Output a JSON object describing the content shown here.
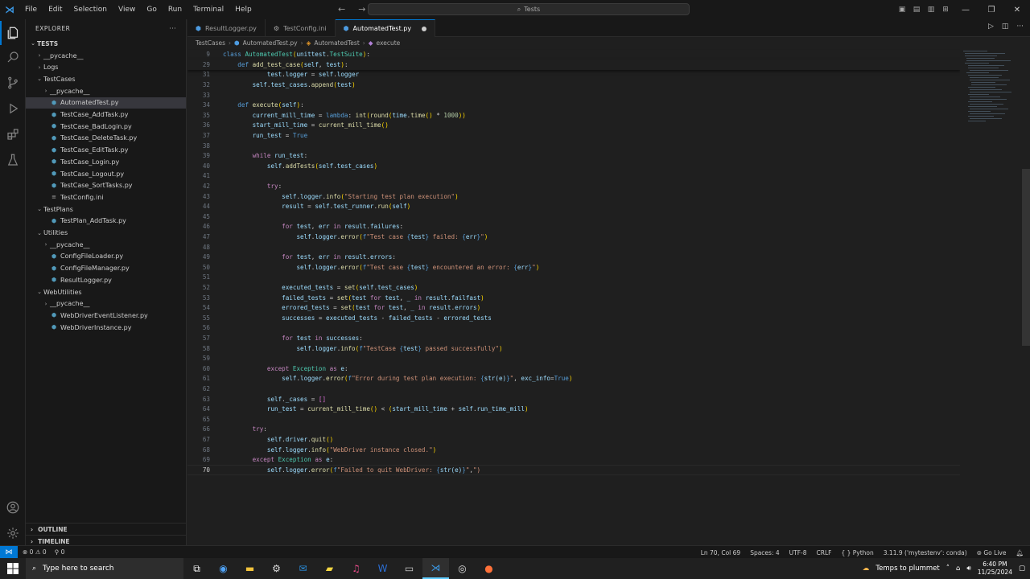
{
  "titlebar": {
    "menus": [
      "File",
      "Edit",
      "Selection",
      "View",
      "Go",
      "Run",
      "Terminal",
      "Help"
    ],
    "search_text": "Tests"
  },
  "sidebar": {
    "header": "EXPLORER",
    "items": [
      {
        "label": "TESTS",
        "depth": 0,
        "kind": "root",
        "chev": "v"
      },
      {
        "label": "__pycache__",
        "depth": 1,
        "kind": "folder",
        "chev": ">"
      },
      {
        "label": "Logs",
        "depth": 1,
        "kind": "folder",
        "chev": ">"
      },
      {
        "label": "TestCases",
        "depth": 1,
        "kind": "folder",
        "chev": "v"
      },
      {
        "label": "__pycache__",
        "depth": 2,
        "kind": "folder",
        "chev": ">"
      },
      {
        "label": "AutomatedTest.py",
        "depth": 2,
        "kind": "py",
        "selected": true
      },
      {
        "label": "TestCase_AddTask.py",
        "depth": 2,
        "kind": "py"
      },
      {
        "label": "TestCase_BadLogin.py",
        "depth": 2,
        "kind": "py"
      },
      {
        "label": "TestCase_DeleteTask.py",
        "depth": 2,
        "kind": "py"
      },
      {
        "label": "TestCase_EditTask.py",
        "depth": 2,
        "kind": "py"
      },
      {
        "label": "TestCase_Login.py",
        "depth": 2,
        "kind": "py"
      },
      {
        "label": "TestCase_Logout.py",
        "depth": 2,
        "kind": "py"
      },
      {
        "label": "TestCase_SortTasks.py",
        "depth": 2,
        "kind": "py"
      },
      {
        "label": "TestConfig.ini",
        "depth": 2,
        "kind": "ini"
      },
      {
        "label": "TestPlans",
        "depth": 1,
        "kind": "folder",
        "chev": "v"
      },
      {
        "label": "TestPlan_AddTask.py",
        "depth": 2,
        "kind": "py"
      },
      {
        "label": "Utilities",
        "depth": 1,
        "kind": "folder",
        "chev": "v"
      },
      {
        "label": "__pycache__",
        "depth": 2,
        "kind": "folder",
        "chev": ">"
      },
      {
        "label": "ConfigFileLoader.py",
        "depth": 2,
        "kind": "py"
      },
      {
        "label": "ConfigFileManager.py",
        "depth": 2,
        "kind": "py"
      },
      {
        "label": "ResultLogger.py",
        "depth": 2,
        "kind": "py"
      },
      {
        "label": "WebUtilities",
        "depth": 1,
        "kind": "folder",
        "chev": "v"
      },
      {
        "label": "__pycache__",
        "depth": 2,
        "kind": "folder",
        "chev": ">"
      },
      {
        "label": "WebDriverEventListener.py",
        "depth": 2,
        "kind": "py"
      },
      {
        "label": "WebDriverInstance.py",
        "depth": 2,
        "kind": "py"
      }
    ],
    "outline": "OUTLINE",
    "timeline": "TIMELINE"
  },
  "tabs": [
    {
      "label": "ResultLogger.py",
      "active": false
    },
    {
      "label": "TestConfig.ini",
      "active": false
    },
    {
      "label": "AutomatedTest.py",
      "active": true
    }
  ],
  "breadcrumb": [
    "TestCases",
    "AutomatedTest.py",
    "AutomatedTest",
    "execute"
  ],
  "editor": {
    "lines": [
      {
        "n": "9",
        "t": "class AutomatedTest(unittest.TestSuite):",
        "sticky": true
      },
      {
        "n": "29",
        "t": "    def add_test_case(self, test):",
        "sticky": true
      },
      {
        "n": "31",
        "t": "            test.logger = self.logger"
      },
      {
        "n": "32",
        "t": "        self.test_cases.append(test)"
      },
      {
        "n": "33",
        "t": ""
      },
      {
        "n": "34",
        "t": "    def execute(self):"
      },
      {
        "n": "35",
        "t": "        current_mill_time = lambda: int(round(time.time() * 1000))"
      },
      {
        "n": "36",
        "t": "        start_mill_time = current_mill_time()"
      },
      {
        "n": "37",
        "t": "        run_test = True"
      },
      {
        "n": "38",
        "t": ""
      },
      {
        "n": "39",
        "t": "        while run_test:"
      },
      {
        "n": "40",
        "t": "            self.addTests(self.test_cases)"
      },
      {
        "n": "41",
        "t": ""
      },
      {
        "n": "42",
        "t": "            try:"
      },
      {
        "n": "43",
        "t": "                self.logger.info(\"Starting test plan execution\")"
      },
      {
        "n": "44",
        "t": "                result = self.test_runner.run(self)"
      },
      {
        "n": "45",
        "t": ""
      },
      {
        "n": "46",
        "t": "                for test, err in result.failures:"
      },
      {
        "n": "47",
        "t": "                    self.logger.error(f\"Test case {test} failed: {err}\")"
      },
      {
        "n": "48",
        "t": ""
      },
      {
        "n": "49",
        "t": "                for test, err in result.errors:"
      },
      {
        "n": "50",
        "t": "                    self.logger.error(f\"Test case {test} encountered an error: {err}\")"
      },
      {
        "n": "51",
        "t": ""
      },
      {
        "n": "52",
        "t": "                executed_tests = set(self.test_cases)"
      },
      {
        "n": "53",
        "t": "                failed_tests = set(test for test, _ in result.failfast)"
      },
      {
        "n": "54",
        "t": "                errored_tests = set(test for test, _ in result.errors)"
      },
      {
        "n": "55",
        "t": "                successes = executed_tests - failed_tests - errored_tests"
      },
      {
        "n": "56",
        "t": ""
      },
      {
        "n": "57",
        "t": "                for test in successes:"
      },
      {
        "n": "58",
        "t": "                    self.logger.info(f\"TestCase {test} passed successfully\")"
      },
      {
        "n": "59",
        "t": ""
      },
      {
        "n": "60",
        "t": "            except Exception as e:"
      },
      {
        "n": "61",
        "t": "                self.logger.error(f\"Error during test plan execution: {str(e)}\", exc_info=True)"
      },
      {
        "n": "62",
        "t": ""
      },
      {
        "n": "63",
        "t": "            self._cases = []"
      },
      {
        "n": "64",
        "t": "            run_test = current_mill_time() < (start_mill_time + self.run_time_mill)"
      },
      {
        "n": "65",
        "t": ""
      },
      {
        "n": "66",
        "t": "        try:"
      },
      {
        "n": "67",
        "t": "            self.driver.quit()"
      },
      {
        "n": "68",
        "t": "            self.logger.info(\"WebDriver instance closed.\")"
      },
      {
        "n": "69",
        "t": "        except Exception as e:"
      },
      {
        "n": "70",
        "t": "            self.logger.error(f\"Failed to quit WebDriver: {str(e)}\",\")",
        "current": true
      }
    ]
  },
  "statusbar": {
    "problems": "⊗ 0 ⚠ 0",
    "ports": "⚲ 0",
    "position": "Ln 70, Col 69",
    "spaces": "Spaces: 4",
    "encoding": "UTF-8",
    "eol": "CRLF",
    "language": "{ } Python",
    "interpreter": "3.11.9 ('mytestenv': conda)",
    "golive": "Go Live"
  },
  "taskbar": {
    "search_placeholder": "Type here to search",
    "weather": "Temps to plummet",
    "time": "6:40 PM",
    "date": "11/25/2024"
  }
}
